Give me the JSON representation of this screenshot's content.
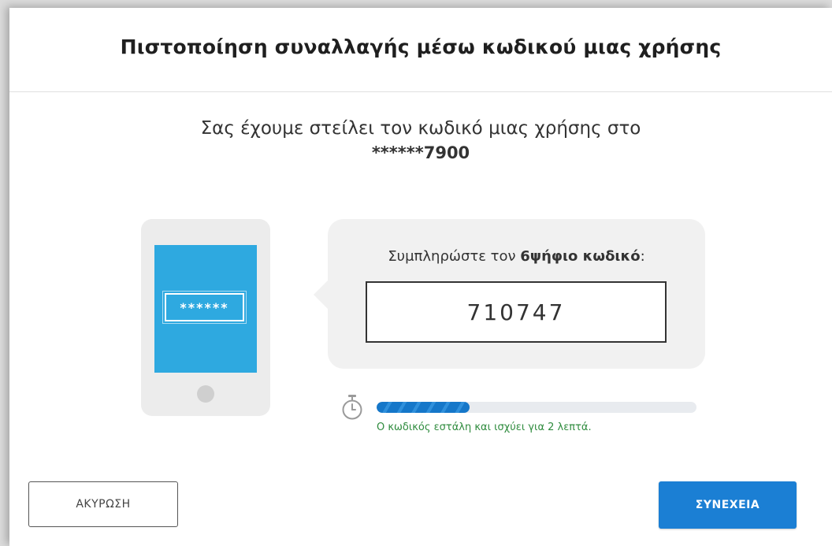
{
  "dialog": {
    "title": "Πιστοποίηση συναλλαγής μέσω κωδικού μιας χρήσης",
    "intro_line": "Σας έχουμε στείλει τον κωδικό μιας χρήσης στο",
    "masked_number": "******7900"
  },
  "phone_graphic": {
    "masked_code": "******",
    "screen_color": "#2ea9e0"
  },
  "code_entry": {
    "prompt_prefix": "Συμπληρώστε τον ",
    "prompt_bold": "6ψήφιο κωδικό",
    "prompt_suffix": ":",
    "value": "710747"
  },
  "timer": {
    "icon": "stopwatch-icon",
    "progress_fraction": 0.29,
    "note": "Ο κωδικός εστάλη και ισχύει για 2 λεπτά.",
    "note_color": "#2e8b3d",
    "bar_color": "#1577c9"
  },
  "actions": {
    "cancel_label": "ΑΚΥΡΩΣΗ",
    "continue_label": "ΣΥΝΕΧΕΙΑ",
    "continue_color": "#1b7fd4"
  }
}
